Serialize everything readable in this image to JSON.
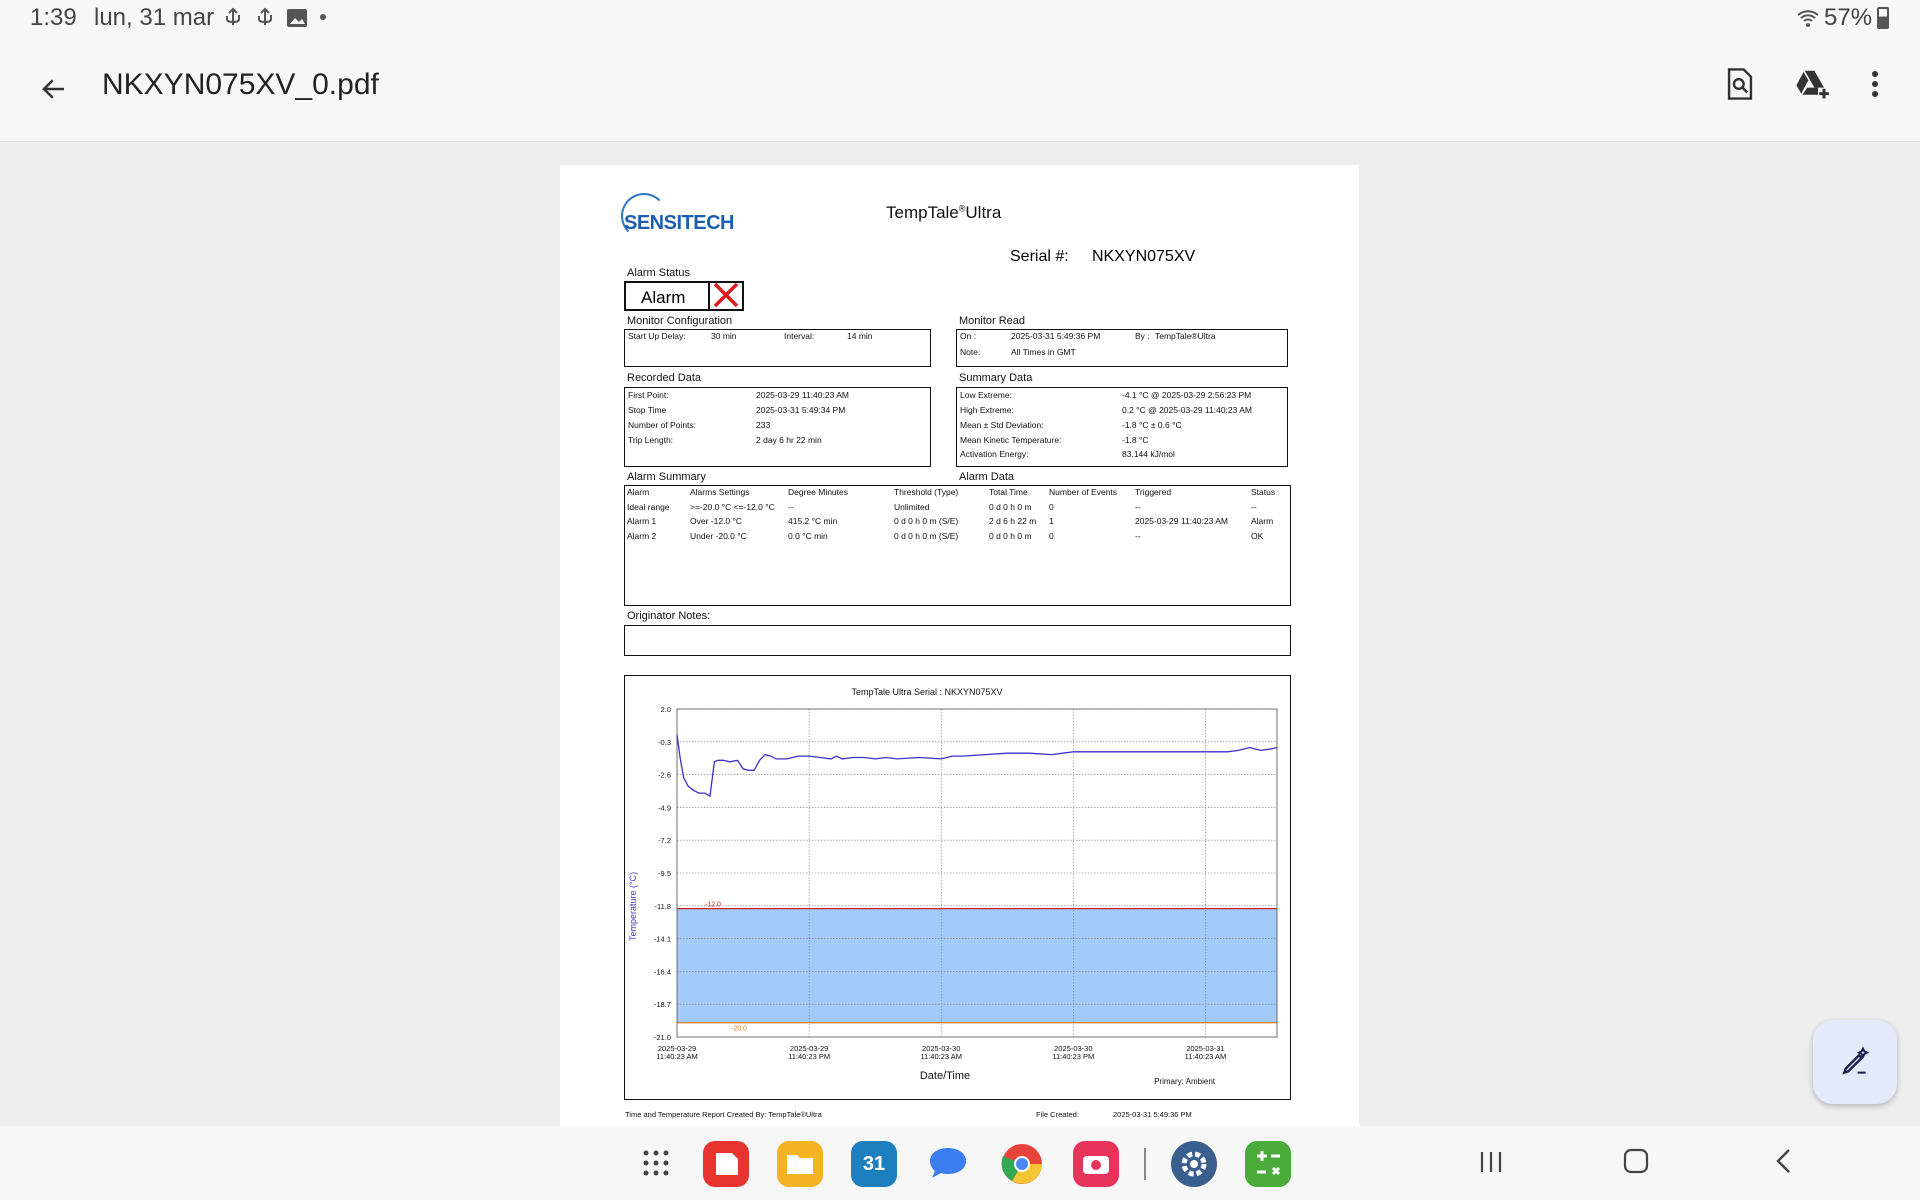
{
  "status_bar": {
    "time": "1:39",
    "date": "lun, 31 mar",
    "battery": "57%"
  },
  "app_bar": {
    "title": "NKXYN075XV_0.pdf"
  },
  "doc": {
    "logo": "SENSITECH",
    "product_title": "TempTale",
    "product_reg": "®",
    "product_suffix": "Ultra",
    "serial_label": "Serial #:",
    "serial_value": "NKXYN075XV",
    "alarm_status_label": "Alarm Status",
    "alarm_text": "Alarm",
    "monitor_config": {
      "label": "Monitor Configuration",
      "startup_label": "Start Up Delay:",
      "startup_value": "30 min",
      "interval_label": "Interval:",
      "interval_value": "14 min"
    },
    "monitor_read": {
      "label": "Monitor Read",
      "on_label": "On :",
      "on_value": "2025-03-31  5:49:36 PM",
      "by_label": "By :",
      "by_value": "TempTale®Ultra",
      "note_label": "Note:",
      "note_value": "All Times in GMT"
    },
    "recorded_data": {
      "label": "Recorded Data",
      "rows": [
        {
          "k": "First Point:",
          "v": "2025-03-29 11:40:23 AM"
        },
        {
          "k": "Stop Time",
          "v": "2025-03-31  5:49:34 PM"
        },
        {
          "k": "Number of Points:",
          "v": "233"
        },
        {
          "k": "Trip Length:",
          "v": "2 day 6 hr 22 min"
        }
      ]
    },
    "summary_data": {
      "label": "Summary Data",
      "rows": [
        {
          "k": "Low Extreme:",
          "v": "-4.1 °C @ 2025-03-29  2:56:23 PM"
        },
        {
          "k": "High Extreme:",
          "v": "0.2 °C @ 2025-03-29 11:40:23 AM"
        },
        {
          "k": "Mean ± Std Deviation:",
          "v": "-1.8 °C ± 0.6 °C"
        },
        {
          "k": "Mean Kinetic Temperature:",
          "v": "-1.8 °C"
        },
        {
          "k": "Activation Energy:",
          "v": "83.144 kJ/mol"
        }
      ]
    },
    "alarm_summary": {
      "label": "Alarm Summary",
      "data_label": "Alarm Data",
      "headers": [
        "Alarm",
        "Alarms Settings",
        "Degree Minutes",
        "Threshold (Type)",
        "Total Time",
        "Number of Events",
        "Triggered",
        "Status"
      ],
      "rows": [
        [
          "Ideal range",
          ">=-20.0 °C <=-12.0 °C",
          "--",
          "Unlimited",
          "0 d 0 h 0 m",
          "0",
          "--",
          "--"
        ],
        [
          "Alarm 1",
          "Over -12.0 °C",
          "415.2 °C min",
          "0 d 0 h 0 m (S/E)",
          "2 d 6 h 22 m",
          "1",
          "2025-03-29 11:40:23 AM",
          "Alarm"
        ],
        [
          "Alarm 2",
          "Under -20.0 °C",
          "0.0 °C min",
          "0 d 0 h 0 m (S/E)",
          "0 d 0 h 0 m",
          "0",
          "--",
          "OK"
        ]
      ]
    },
    "originator_notes_label": "Originator Notes:",
    "footer_left": "Time and Temperature Report Created By:  TempTale®Ultra",
    "footer_mid_label": "File Created:",
    "footer_mid_value": "2025-03-31  5:49:36 PM"
  },
  "chart_data": {
    "type": "line",
    "title": "TempTale Ultra  Serial : NKXYN075XV",
    "xlabel": "Date/Time",
    "ylabel": "Temperature    (°C)",
    "primary_label": "Primary: Ambient",
    "ylim": [
      -21.0,
      2.0
    ],
    "yticks": [
      "2.0",
      "-0.3",
      "-2.6",
      "-4.9",
      "-7.2",
      "-9.5",
      "-11.8",
      "-14.1",
      "-16.4",
      "-18.7",
      "-21.0"
    ],
    "xticks": [
      {
        "date": "2025-03-29",
        "time": "11:40:23 AM"
      },
      {
        "date": "2025-03-29",
        "time": "11:40:23 PM"
      },
      {
        "date": "2025-03-30",
        "time": "11:40:23 AM"
      },
      {
        "date": "2025-03-30",
        "time": "11:40:23 PM"
      },
      {
        "date": "2025-03-31",
        "time": "11:40:23 AM"
      }
    ],
    "x_hours_range": [
      0,
      54.5
    ],
    "alarm_high": {
      "value": -12.0,
      "label": "-12.0",
      "color": "#cc2222"
    },
    "alarm_low": {
      "value": -20.0,
      "label": "-20.0",
      "color": "#e07a1a"
    },
    "band_color": "#a3cbfa",
    "series": [
      {
        "color": "#3b2fc9",
        "x": [
          0,
          0.3,
          0.6,
          1.0,
          1.5,
          2.0,
          2.5,
          3.0,
          3.4,
          3.7,
          4.2,
          4.8,
          5.5,
          6.0,
          6.5,
          7.0,
          7.5,
          8.0,
          8.5,
          9.0,
          9.5,
          10.0,
          11.0,
          12.0,
          13.0,
          14.0,
          14.5,
          15.0,
          16.0,
          17.0,
          18.0,
          19.0,
          20.0,
          22.0,
          24.0,
          25.0,
          26.0,
          28.0,
          30.0,
          32.0,
          34.0,
          36.0,
          38.0,
          40.0,
          42.0,
          44.0,
          46.0,
          48.0,
          50.0,
          51.0,
          52.0,
          53.0,
          54.0,
          54.5
        ],
        "values": [
          0.2,
          -1.5,
          -2.8,
          -3.4,
          -3.7,
          -3.9,
          -3.9,
          -4.1,
          -1.7,
          -1.6,
          -1.6,
          -1.7,
          -1.6,
          -2.2,
          -2.3,
          -2.3,
          -1.6,
          -1.2,
          -1.3,
          -1.5,
          -1.5,
          -1.5,
          -1.3,
          -1.3,
          -1.4,
          -1.5,
          -1.3,
          -1.5,
          -1.4,
          -1.4,
          -1.5,
          -1.4,
          -1.5,
          -1.4,
          -1.5,
          -1.3,
          -1.3,
          -1.2,
          -1.1,
          -1.1,
          -1.2,
          -1.0,
          -1.0,
          -1.0,
          -1.0,
          -1.0,
          -1.0,
          -1.0,
          -1.0,
          -0.9,
          -0.7,
          -0.9,
          -0.8,
          -0.7
        ]
      }
    ]
  },
  "nav": {
    "apps": [
      "apps-grid",
      "notes",
      "files",
      "calendar",
      "messages",
      "chrome",
      "camera",
      "settings",
      "calculator"
    ],
    "calendar_day": "31"
  }
}
